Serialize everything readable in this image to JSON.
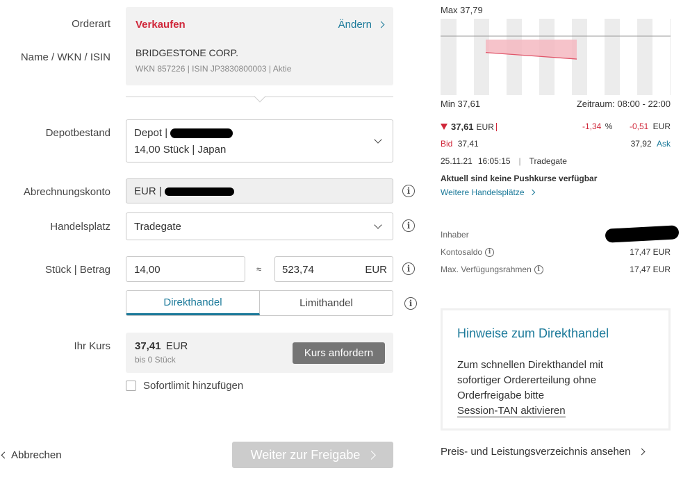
{
  "order": {
    "orderart_label": "Orderart",
    "name_label": "Name / WKN / ISIN",
    "type_value": "Verkaufen",
    "change_label": "Ändern",
    "security_name": "BRIDGESTONE CORP.",
    "security_meta": "WKN 857226 | ISIN JP3830800003 | Aktie"
  },
  "depot": {
    "label": "Depotbestand",
    "line1": "Depot |",
    "line2": "14,00 Stück | Japan"
  },
  "account": {
    "label": "Abrechnungskonto",
    "value": "EUR |"
  },
  "venue": {
    "label": "Handelsplatz",
    "value": "Tradegate"
  },
  "amount": {
    "label": "Stück | Betrag",
    "pieces": "14,00",
    "approx": "≈",
    "total": "523,74",
    "currency": "EUR"
  },
  "tabs": {
    "direct": "Direkthandel",
    "limit": "Limithandel"
  },
  "quote": {
    "label": "Ihr Kurs",
    "price": "37,41",
    "currency": "EUR",
    "sub": "bis 0 Stück",
    "button": "Kurs anfordern"
  },
  "sofortlimit": "Sofortlimit hinzufügen",
  "footer": {
    "cancel": "Abbrechen",
    "next": "Weiter zur Freigabe"
  },
  "chart_data": {
    "type": "area",
    "max_label": "Max 37,79",
    "min_label": "Min 37,61",
    "range_label": "Zeitraum: 08:00 - 22:00",
    "ylim": [
      37.61,
      37.79
    ],
    "values": [
      37.74,
      37.72
    ]
  },
  "ticker": {
    "price": "37,61",
    "currency": "EUR",
    "change_pct": "-1,34",
    "pct_sign": "%",
    "change_abs": "-0,51",
    "change_cur": "EUR",
    "bid_label": "Bid",
    "bid": "37,41",
    "ask": "37,92",
    "ask_label": "Ask",
    "date": "25.11.21",
    "time": "16:05:15",
    "sep": "|",
    "venue": "Tradegate",
    "push_note": "Aktuell sind keine Pushkurse verfügbar",
    "more_venues": "Weitere Handelsplätze"
  },
  "account_info": {
    "owner_label": "Inhaber",
    "balance_label": "Kontosaldo",
    "balance": "17,47 EUR",
    "limit_label": "Max. Verfügungsrahmen",
    "limit": "17,47 EUR"
  },
  "hint": {
    "title": "Hinweise zum Direkthandel",
    "text": "Zum schnellen Direkthandel mit sofortiger Ordererteilung ohne Orderfreigabe bitte",
    "link": "Session-TAN aktivieren"
  },
  "price_list_link": "Preis- und Leistungsverzeichnis ansehen",
  "colors": {
    "accent": "#1c7a9a",
    "sell": "#d0273a",
    "button_dark": "#757575",
    "button_disabled": "#cccccc"
  }
}
